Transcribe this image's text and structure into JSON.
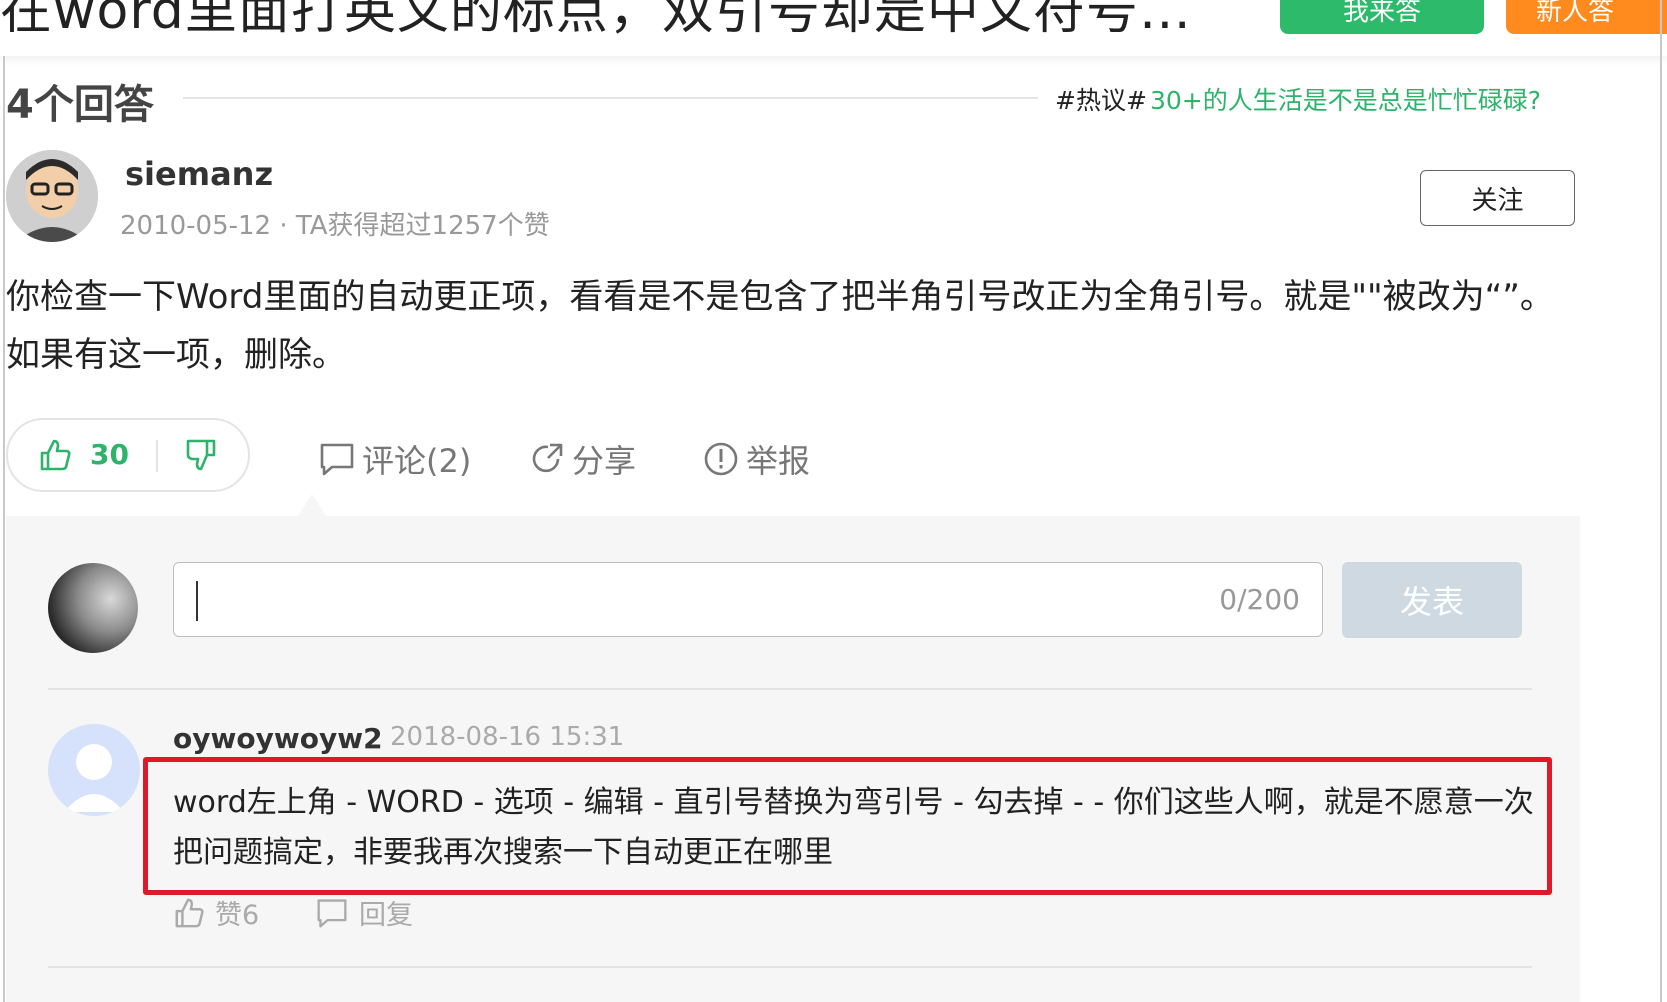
{
  "header": {
    "question_title": "在word里面打英文的标点，双引号却是中文符号…",
    "answer_button": "我来答",
    "new_button": "新人答"
  },
  "answers": {
    "count_label": "4个回答",
    "hot_tag": "#热议#",
    "hot_link": "30+的人生活是不是总是忙忙碌碌?"
  },
  "answer": {
    "author": "siemanz",
    "meta": "2010-05-12 · TA获得超过1257个赞",
    "follow_label": "关注",
    "body": "你检查一下Word里面的自动更正项，看看是不是包含了把半角引号改正为全角引号。就是\"\"被改为“”。如果有这一项，删除。",
    "likes": "30",
    "comment_label": "评论(2)",
    "share_label": "分享",
    "report_label": "举报"
  },
  "comment_box": {
    "counter": "0/200",
    "post_label": "发表"
  },
  "comment": {
    "author": "oywoywoyw2",
    "time": "2018-08-16 15:31",
    "text": "word左上角 - WORD - 选项 - 编辑 - 直引号替换为弯引号 - 勾去掉  -  - 你们这些人啊，就是不愿意一次把问题搞定，非要我再次搜索一下自动更正在哪里",
    "like_label": "赞6",
    "reply_label": "回复"
  },
  "colors": {
    "green": "#2db36a",
    "orange": "#ff8a1e",
    "highlight": "#e0192a"
  }
}
